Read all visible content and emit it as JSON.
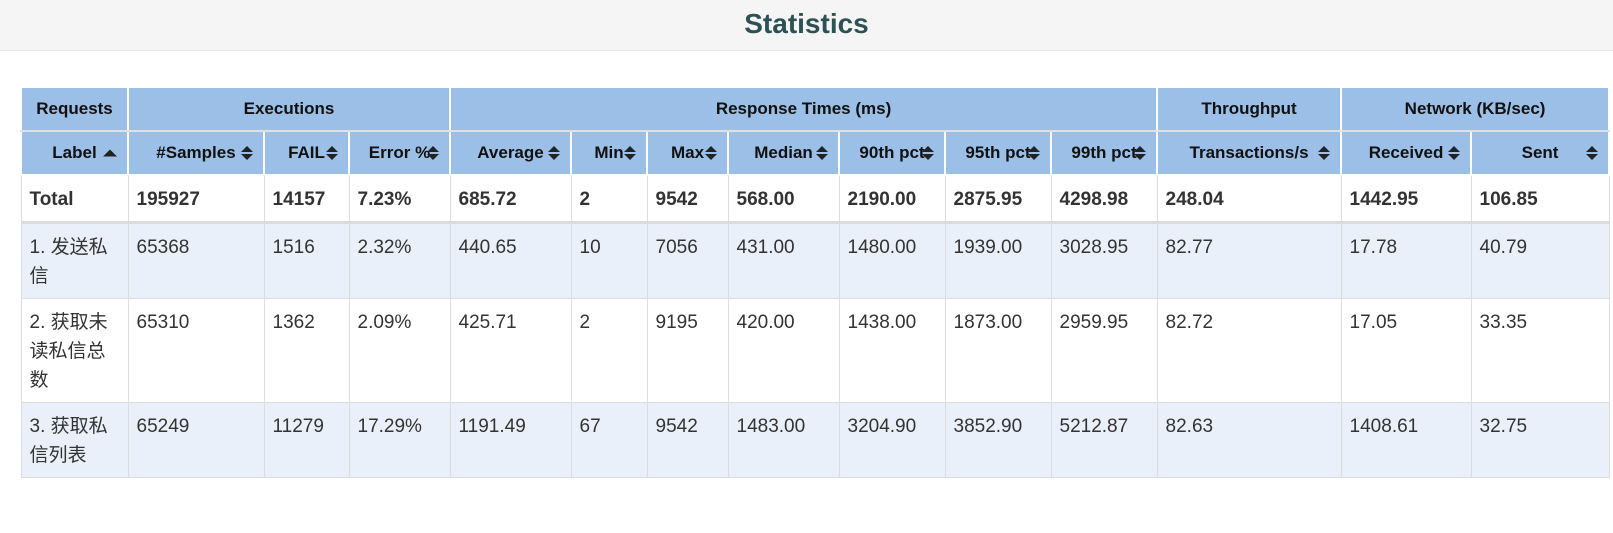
{
  "page": {
    "title": "Statistics"
  },
  "table": {
    "groups": [
      {
        "label": "Requests",
        "colspan": 1
      },
      {
        "label": "Executions",
        "colspan": 3
      },
      {
        "label": "Response Times (ms)",
        "colspan": 7
      },
      {
        "label": "Throughput",
        "colspan": 1
      },
      {
        "label": "Network (KB/sec)",
        "colspan": 2
      }
    ],
    "columns": [
      {
        "label": "Label",
        "sort": "asc"
      },
      {
        "label": "#Samples",
        "sort": "both"
      },
      {
        "label": "FAIL",
        "sort": "both"
      },
      {
        "label": "Error %",
        "sort": "both"
      },
      {
        "label": "Average",
        "sort": "both"
      },
      {
        "label": "Min",
        "sort": "both"
      },
      {
        "label": "Max",
        "sort": "both"
      },
      {
        "label": "Median",
        "sort": "both"
      },
      {
        "label": "90th pct",
        "sort": "both"
      },
      {
        "label": "95th pct",
        "sort": "both"
      },
      {
        "label": "99th pct",
        "sort": "both"
      },
      {
        "label": "Transactions/s",
        "sort": "both"
      },
      {
        "label": "Received",
        "sort": "both"
      },
      {
        "label": "Sent",
        "sort": "both"
      }
    ],
    "total": [
      "Total",
      "195927",
      "14157",
      "7.23%",
      "685.72",
      "2",
      "9542",
      "568.00",
      "2190.00",
      "2875.95",
      "4298.98",
      "248.04",
      "1442.95",
      "106.85"
    ],
    "rows": [
      [
        "1. 发送私信",
        "65368",
        "1516",
        "2.32%",
        "440.65",
        "10",
        "7056",
        "431.00",
        "1480.00",
        "1939.00",
        "3028.95",
        "82.77",
        "17.78",
        "40.79"
      ],
      [
        "2. 获取未读私信总数",
        "65310",
        "1362",
        "2.09%",
        "425.71",
        "2",
        "9195",
        "420.00",
        "1438.00",
        "1873.00",
        "2959.95",
        "82.72",
        "17.05",
        "33.35"
      ],
      [
        "3. 获取私信列表",
        "65249",
        "11279",
        "17.29%",
        "1191.49",
        "67",
        "9542",
        "1483.00",
        "3204.90",
        "3852.90",
        "5212.87",
        "82.63",
        "1408.61",
        "32.75"
      ]
    ]
  },
  "colors": {
    "header_bg": "#9bbfe6",
    "title_color": "#2d5154",
    "odd_row_bg": "#e9f0f9"
  }
}
